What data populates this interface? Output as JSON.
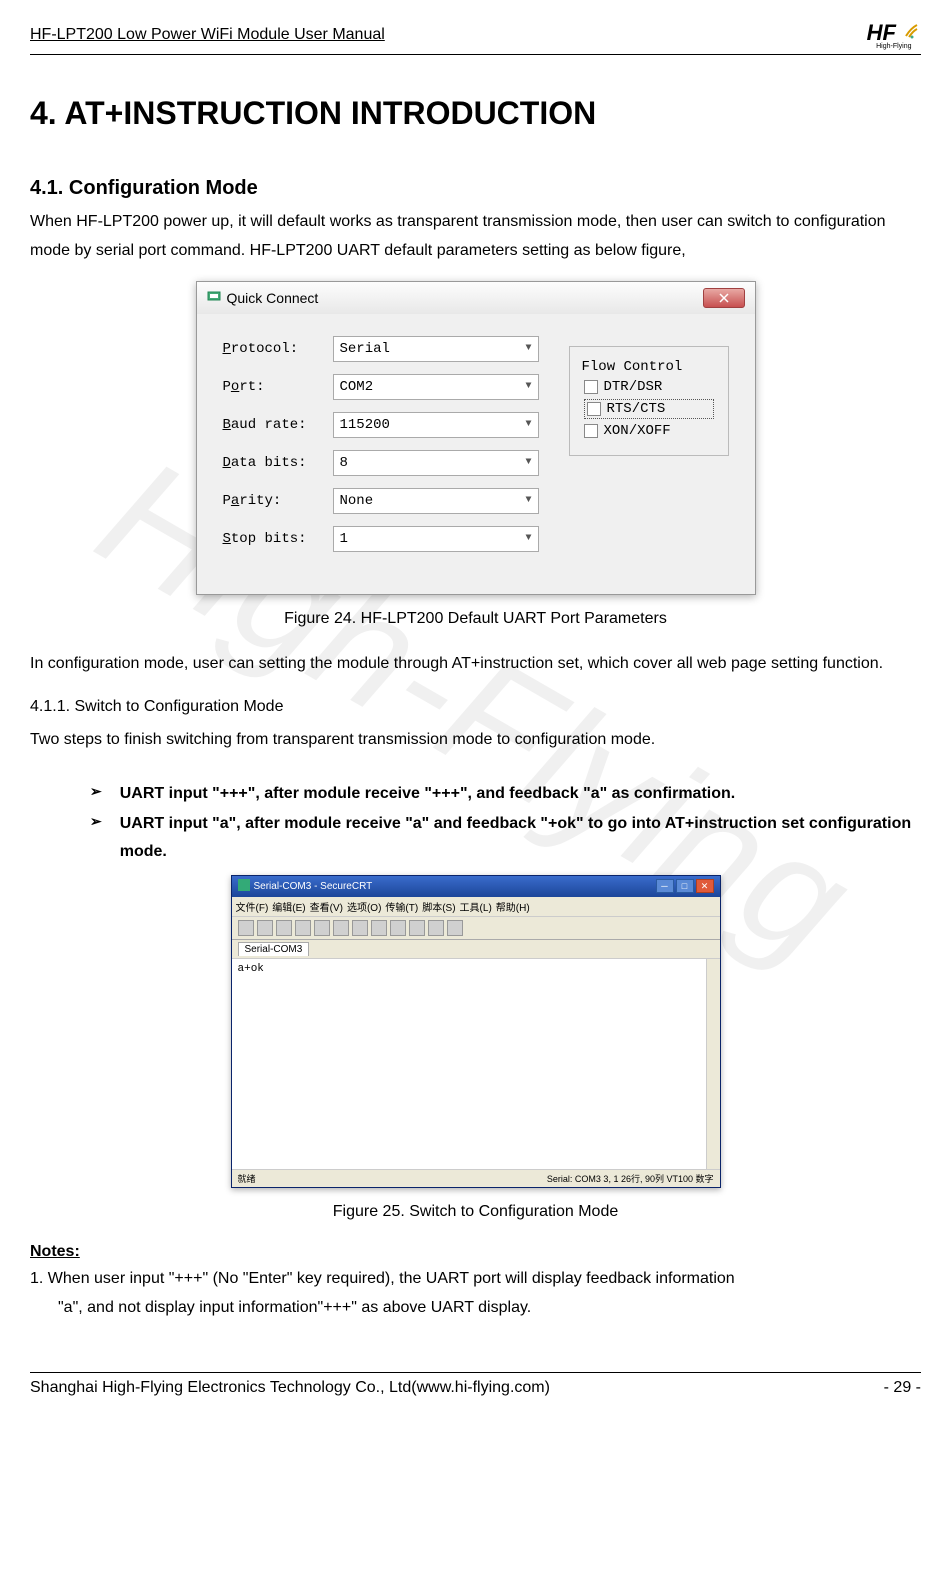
{
  "header": {
    "title": "HF-LPT200 Low Power WiFi Module User Manual",
    "logo_text": "HF",
    "logo_sub": "High-Flying"
  },
  "watermark": "High-Flying",
  "chapter_title": "4. AT+INSTRUCTION INTRODUCTION",
  "section41": {
    "number_title": "4.1.  Configuration Mode",
    "p1": "When HF-LPT200 power up, it will default works as transparent transmission mode, then user can switch to configuration mode by serial port command. HF-LPT200 UART default parameters setting as below figure,"
  },
  "quick_connect": {
    "title": "Quick Connect",
    "fields": {
      "protocol_label": "Protocol:",
      "protocol_value": "Serial",
      "port_label": "Port:",
      "port_value": "COM2",
      "baud_label": "Baud rate:",
      "baud_value": "115200",
      "data_label": "Data bits:",
      "data_value": "8",
      "parity_label": "Parity:",
      "parity_value": "None",
      "stop_label": "Stop bits:",
      "stop_value": "1"
    },
    "flow_control": {
      "legend": "Flow Control",
      "opt1": "DTR/DSR",
      "opt2": "RTS/CTS",
      "opt3": "XON/XOFF"
    }
  },
  "figure24": "Figure 24.   HF-LPT200 Default UART Port Parameters",
  "p2": "In configuration mode, user can setting the module through AT+instruction set, which cover all web page setting function.",
  "section411": {
    "title": "4.1.1.   Switch to Configuration Mode",
    "intro": "Two steps to finish switching from transparent transmission mode to configuration mode."
  },
  "bullets": {
    "b1": "UART input \"+++\", after module receive \"+++\", and feedback \"a\" as confirmation.",
    "b2": "UART input \"a\", after module receive \"a\" and feedback \"+ok\" to go into AT+instruction set configuration mode."
  },
  "securecrt": {
    "title": "Serial-COM3 - SecureCRT",
    "menus": [
      "文件(F)",
      "编辑(E)",
      "查看(V)",
      "选项(O)",
      "传输(T)",
      "脚本(S)",
      "工具(L)",
      "帮助(H)"
    ],
    "tab": "Serial-COM3",
    "terminal_line": "a+ok",
    "status_left": "就绪",
    "status_right": "Serial: COM3    3,    1    26行, 90列  VT100            数字"
  },
  "figure25": "Figure 25.   Switch to Configuration Mode",
  "notes": {
    "heading": "Notes:",
    "n1_l1": "1. When user input \"+++\" (No \"Enter\" key required), the UART port will display feedback information",
    "n1_l2": "\"a\", and not display input information\"+++\" as above UART display."
  },
  "footer": {
    "left": "Shanghai High-Flying Electronics Technology Co., Ltd(www.hi-flying.com)",
    "right": "- 29 -"
  }
}
